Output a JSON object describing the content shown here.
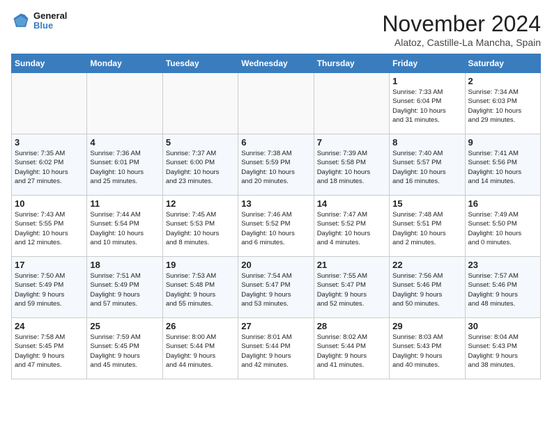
{
  "header": {
    "logo_line1": "General",
    "logo_line2": "Blue",
    "month": "November 2024",
    "location": "Alatoz, Castille-La Mancha, Spain"
  },
  "days_of_week": [
    "Sunday",
    "Monday",
    "Tuesday",
    "Wednesday",
    "Thursday",
    "Friday",
    "Saturday"
  ],
  "weeks": [
    [
      {
        "day": "",
        "info": ""
      },
      {
        "day": "",
        "info": ""
      },
      {
        "day": "",
        "info": ""
      },
      {
        "day": "",
        "info": ""
      },
      {
        "day": "",
        "info": ""
      },
      {
        "day": "1",
        "info": "Sunrise: 7:33 AM\nSunset: 6:04 PM\nDaylight: 10 hours\nand 31 minutes."
      },
      {
        "day": "2",
        "info": "Sunrise: 7:34 AM\nSunset: 6:03 PM\nDaylight: 10 hours\nand 29 minutes."
      }
    ],
    [
      {
        "day": "3",
        "info": "Sunrise: 7:35 AM\nSunset: 6:02 PM\nDaylight: 10 hours\nand 27 minutes."
      },
      {
        "day": "4",
        "info": "Sunrise: 7:36 AM\nSunset: 6:01 PM\nDaylight: 10 hours\nand 25 minutes."
      },
      {
        "day": "5",
        "info": "Sunrise: 7:37 AM\nSunset: 6:00 PM\nDaylight: 10 hours\nand 23 minutes."
      },
      {
        "day": "6",
        "info": "Sunrise: 7:38 AM\nSunset: 5:59 PM\nDaylight: 10 hours\nand 20 minutes."
      },
      {
        "day": "7",
        "info": "Sunrise: 7:39 AM\nSunset: 5:58 PM\nDaylight: 10 hours\nand 18 minutes."
      },
      {
        "day": "8",
        "info": "Sunrise: 7:40 AM\nSunset: 5:57 PM\nDaylight: 10 hours\nand 16 minutes."
      },
      {
        "day": "9",
        "info": "Sunrise: 7:41 AM\nSunset: 5:56 PM\nDaylight: 10 hours\nand 14 minutes."
      }
    ],
    [
      {
        "day": "10",
        "info": "Sunrise: 7:43 AM\nSunset: 5:55 PM\nDaylight: 10 hours\nand 12 minutes."
      },
      {
        "day": "11",
        "info": "Sunrise: 7:44 AM\nSunset: 5:54 PM\nDaylight: 10 hours\nand 10 minutes."
      },
      {
        "day": "12",
        "info": "Sunrise: 7:45 AM\nSunset: 5:53 PM\nDaylight: 10 hours\nand 8 minutes."
      },
      {
        "day": "13",
        "info": "Sunrise: 7:46 AM\nSunset: 5:52 PM\nDaylight: 10 hours\nand 6 minutes."
      },
      {
        "day": "14",
        "info": "Sunrise: 7:47 AM\nSunset: 5:52 PM\nDaylight: 10 hours\nand 4 minutes."
      },
      {
        "day": "15",
        "info": "Sunrise: 7:48 AM\nSunset: 5:51 PM\nDaylight: 10 hours\nand 2 minutes."
      },
      {
        "day": "16",
        "info": "Sunrise: 7:49 AM\nSunset: 5:50 PM\nDaylight: 10 hours\nand 0 minutes."
      }
    ],
    [
      {
        "day": "17",
        "info": "Sunrise: 7:50 AM\nSunset: 5:49 PM\nDaylight: 9 hours\nand 59 minutes."
      },
      {
        "day": "18",
        "info": "Sunrise: 7:51 AM\nSunset: 5:49 PM\nDaylight: 9 hours\nand 57 minutes."
      },
      {
        "day": "19",
        "info": "Sunrise: 7:53 AM\nSunset: 5:48 PM\nDaylight: 9 hours\nand 55 minutes."
      },
      {
        "day": "20",
        "info": "Sunrise: 7:54 AM\nSunset: 5:47 PM\nDaylight: 9 hours\nand 53 minutes."
      },
      {
        "day": "21",
        "info": "Sunrise: 7:55 AM\nSunset: 5:47 PM\nDaylight: 9 hours\nand 52 minutes."
      },
      {
        "day": "22",
        "info": "Sunrise: 7:56 AM\nSunset: 5:46 PM\nDaylight: 9 hours\nand 50 minutes."
      },
      {
        "day": "23",
        "info": "Sunrise: 7:57 AM\nSunset: 5:46 PM\nDaylight: 9 hours\nand 48 minutes."
      }
    ],
    [
      {
        "day": "24",
        "info": "Sunrise: 7:58 AM\nSunset: 5:45 PM\nDaylight: 9 hours\nand 47 minutes."
      },
      {
        "day": "25",
        "info": "Sunrise: 7:59 AM\nSunset: 5:45 PM\nDaylight: 9 hours\nand 45 minutes."
      },
      {
        "day": "26",
        "info": "Sunrise: 8:00 AM\nSunset: 5:44 PM\nDaylight: 9 hours\nand 44 minutes."
      },
      {
        "day": "27",
        "info": "Sunrise: 8:01 AM\nSunset: 5:44 PM\nDaylight: 9 hours\nand 42 minutes."
      },
      {
        "day": "28",
        "info": "Sunrise: 8:02 AM\nSunset: 5:44 PM\nDaylight: 9 hours\nand 41 minutes."
      },
      {
        "day": "29",
        "info": "Sunrise: 8:03 AM\nSunset: 5:43 PM\nDaylight: 9 hours\nand 40 minutes."
      },
      {
        "day": "30",
        "info": "Sunrise: 8:04 AM\nSunset: 5:43 PM\nDaylight: 9 hours\nand 38 minutes."
      }
    ]
  ]
}
